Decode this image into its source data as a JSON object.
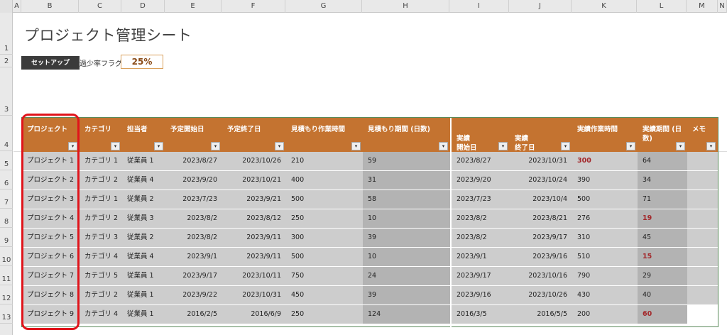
{
  "columns": [
    "A",
    "B",
    "C",
    "D",
    "E",
    "F",
    "G",
    "H",
    "I",
    "J",
    "K",
    "L",
    "M",
    "N"
  ],
  "rows": [
    "1",
    "2",
    "3",
    "4",
    "5",
    "6",
    "7",
    "8",
    "9",
    "10",
    "11",
    "12",
    "13"
  ],
  "title": "プロジェクト管理シート",
  "setup_button": "セットアップ",
  "flag_label": "過少率フラグ:",
  "flag_value": "25%",
  "headers": {
    "project": "プロジェクト",
    "category": "カテゴリ",
    "assignee": "担当者",
    "plan_start": "予定開始日",
    "plan_end": "予定終了日",
    "est_hours": "見積もり作業時間",
    "est_days": "見積もり期間 (日数)",
    "act_start": "実績\n開始日",
    "act_end": "実績\n終了日",
    "act_hours": "実績作業時間",
    "act_days": "実績期間 (日数)",
    "memo": "メモ"
  },
  "filter_icon": "▾",
  "table": [
    [
      "プロジェクト 1",
      "カテゴリ 1",
      "従業員 1",
      "2023/8/27",
      "2023/10/26",
      "210",
      "59",
      "2023/8/27",
      "2023/10/31",
      "300",
      "64",
      ""
    ],
    [
      "プロジェクト 2",
      "カテゴリ 2",
      "従業員 4",
      "2023/9/20",
      "2023/10/21",
      "400",
      "31",
      "2023/9/20",
      "2023/10/24",
      "390",
      "34",
      ""
    ],
    [
      "プロジェクト 3",
      "カテゴリ 1",
      "従業員 2",
      "2023/7/23",
      "2023/9/21",
      "500",
      "58",
      "2023/7/23",
      "2023/10/4",
      "500",
      "71",
      ""
    ],
    [
      "プロジェクト 4",
      "カテゴリ 2",
      "従業員 3",
      "2023/8/2",
      "2023/8/12",
      "250",
      "10",
      "2023/8/2",
      "2023/8/21",
      "276",
      "19",
      ""
    ],
    [
      "プロジェクト 5",
      "カテゴリ 3",
      "従業員 2",
      "2023/8/2",
      "2023/9/11",
      "300",
      "39",
      "2023/8/2",
      "2023/9/17",
      "310",
      "45",
      ""
    ],
    [
      "プロジェクト 6",
      "カテゴリ 4",
      "従業員 4",
      "2023/9/1",
      "2023/9/11",
      "500",
      "10",
      "2023/9/1",
      "2023/9/16",
      "510",
      "15",
      ""
    ],
    [
      "プロジェクト 7",
      "カテゴリ 5",
      "従業員 1",
      "2023/9/17",
      "2023/10/11",
      "750",
      "24",
      "2023/9/17",
      "2023/10/16",
      "790",
      "29",
      ""
    ],
    [
      "プロジェクト 8",
      "カテゴリ 2",
      "従業員 1",
      "2023/9/22",
      "2023/10/31",
      "450",
      "39",
      "2023/9/16",
      "2023/10/26",
      "430",
      "40",
      ""
    ],
    [
      "プロジェクト 9",
      "カテゴリ 4",
      "従業員 1",
      "2016/2/5",
      "2016/6/9",
      "250",
      "124",
      "2016/3/5",
      "2016/5/5",
      "200",
      "60",
      ""
    ]
  ],
  "red_cells": [
    [
      0,
      9
    ],
    [
      3,
      10
    ],
    [
      5,
      10
    ],
    [
      8,
      10
    ]
  ],
  "colors": {
    "header_bg": "#c47330",
    "cell_bg": "#cdcdcd",
    "cell_alt": "#b3b3b3",
    "flag_red": "#a3282b",
    "highlight": "#e0141b"
  }
}
